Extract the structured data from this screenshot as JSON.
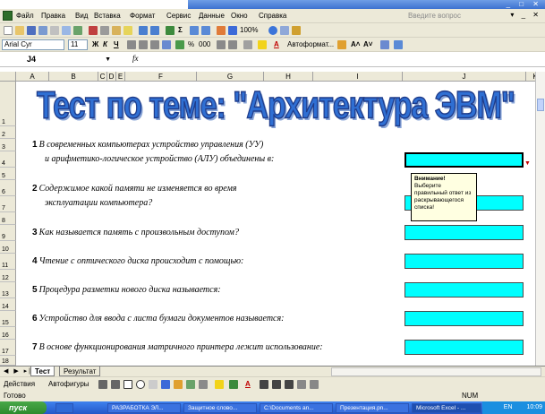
{
  "menu": {
    "items": [
      "Файл",
      "Правка",
      "Вид",
      "Вставка",
      "Формат",
      "Сервис",
      "Данные",
      "Окно",
      "Справка"
    ],
    "help_placeholder": "Введите вопрос"
  },
  "format_toolbar": {
    "font": "Arial Cyr",
    "size": "11",
    "bold": "Ж",
    "italic": "К",
    "underline": "Ч",
    "percent": "%",
    "thousands": "000",
    "autoformat": "Автоформат...",
    "zoom": "100%"
  },
  "formula_bar": {
    "cell_ref": "J4",
    "fx": "fx"
  },
  "columns": [
    "A",
    "B",
    "C",
    "D",
    "E",
    "F",
    "G",
    "H",
    "I",
    "J",
    "K"
  ],
  "rows": [
    "1",
    "2",
    "3",
    "4",
    "5",
    "6",
    "7",
    "8",
    "9",
    "10",
    "11",
    "12",
    "13",
    "14",
    "15",
    "16",
    "17",
    "18"
  ],
  "title": "Тест по теме: \"Архитектура ЭВМ\"",
  "questions": [
    {
      "num": "1",
      "line1": "В современных компьютерах устройство управления (УУ)",
      "line2": "и арифметико-логическое устройство (АЛУ) объединены в:"
    },
    {
      "num": "2",
      "line1": "Содержимое какой памяти не изменяется во время",
      "line2": "эксплуатации компьютера?"
    },
    {
      "num": "3",
      "line1": "Как называется память с произвольным доступом?",
      "line2": ""
    },
    {
      "num": "4",
      "line1": "Чтение с оптического диска происходит с помощью:",
      "line2": ""
    },
    {
      "num": "5",
      "line1": "Процедура разметки нового диска называется:",
      "line2": ""
    },
    {
      "num": "6",
      "line1": "Устройство для ввода с листа бумаги документов называется:",
      "line2": ""
    },
    {
      "num": "7",
      "line1": "В основе функционирования матричного принтера лежит использование:",
      "line2": ""
    }
  ],
  "tooltip": {
    "title": "Внимание!",
    "text": "Выберите правильный ответ из раскрывающегося списка!"
  },
  "sheet_tabs": [
    "Тест",
    "Результат"
  ],
  "draw_toolbar": {
    "actions": "Действия",
    "autoshapes": "Автофигуры"
  },
  "status": {
    "left": "Готово",
    "right": "NUM"
  },
  "taskbar": {
    "start": "пуск",
    "tasks": [
      "РАЗРАБОТКА ЭЛ...",
      "Защитное слово...",
      "C:\\Documents an...",
      "Презентация.pn...",
      "Microsoft Excel - ..."
    ],
    "lang": "EN",
    "clock": "10:09"
  },
  "colors": {
    "answer_fill": "#00ffff",
    "title_fill": "#2f6fd3",
    "tooltip_bg": "#ffffe1"
  }
}
